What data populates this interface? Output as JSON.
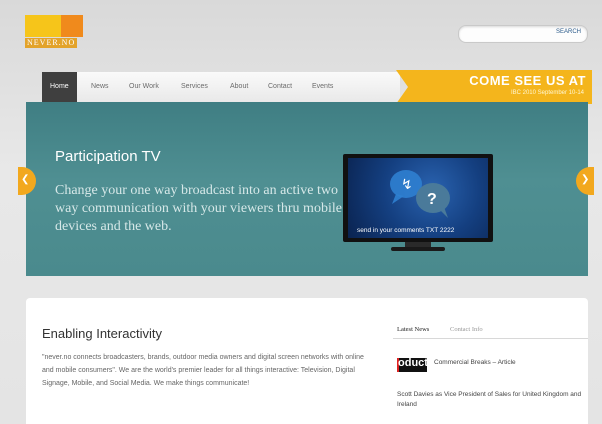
{
  "brand": {
    "logo_text": "NEVER.NO"
  },
  "search": {
    "placeholder": "",
    "button_label": "SEARCH"
  },
  "nav": {
    "items": [
      {
        "label": "Home"
      },
      {
        "label": "News"
      },
      {
        "label": "Our Work"
      },
      {
        "label": "Services"
      },
      {
        "label": "About"
      },
      {
        "label": "Contact"
      },
      {
        "label": "Events"
      }
    ]
  },
  "promo": {
    "headline": "COME SEE US AT",
    "subline": "IBC 2010 September 10-14"
  },
  "hero": {
    "title": "Participation TV",
    "description": "Change your one way broadcast into an active two way communication with your viewers thru mobile devices and the web.",
    "tv_caption": "send in your comments TXT 2222"
  },
  "main": {
    "heading": "Enabling Interactivity",
    "body": "\"never.no connects broadcasters, brands, outdoor media owners and digital screen networks with online and mobile consumers\". We are the world's premier leader for all things interactive: Television, Digital Signage, Mobile, and Social Media. We make things communicate!"
  },
  "sidebar": {
    "tabs": [
      {
        "label": "Latest News"
      },
      {
        "label": "Contact Info"
      }
    ],
    "thumb_text": "oduct",
    "items": [
      {
        "text": "Commercial Breaks – Article"
      },
      {
        "text": "Scott Davies as Vice President of Sales for United Kingdom and Ireland"
      }
    ]
  },
  "colors": {
    "accent": "#f2a81e",
    "hero_bg": "#4a8a8d",
    "nav_active": "#3f3f3f"
  }
}
